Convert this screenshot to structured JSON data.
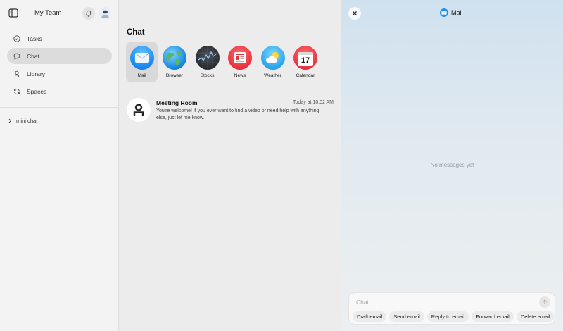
{
  "sidebar": {
    "title": "My Team",
    "toggle_icon": "sidebar-toggle-icon",
    "notifications_icon": "bell-icon",
    "nav": [
      {
        "label": "Tasks",
        "icon": "check-circle-icon",
        "active": false
      },
      {
        "label": "Chat",
        "icon": "chat-bubble-icon",
        "active": true
      },
      {
        "label": "Library",
        "icon": "person-icon",
        "active": false
      },
      {
        "label": "Spaces",
        "icon": "refresh-icon",
        "active": false
      }
    ],
    "mini_chat": "mini chat"
  },
  "chat_list": {
    "title": "Chat",
    "apps": [
      {
        "label": "Mail",
        "icon": "mail-icon",
        "selected": true
      },
      {
        "label": "Browser",
        "icon": "globe-icon",
        "selected": false
      },
      {
        "label": "Stocks",
        "icon": "stocks-icon",
        "selected": false
      },
      {
        "label": "News",
        "icon": "news-icon",
        "selected": false
      },
      {
        "label": "Weather",
        "icon": "weather-icon",
        "selected": false
      },
      {
        "label": "Calendar",
        "icon": "calendar-icon",
        "selected": false,
        "day": "17"
      }
    ],
    "conversation": {
      "name": "Meeting Room",
      "time": "Today at 10:02 AM",
      "preview": "You're welcome! If you ever want to find a video or need help with anything else, just let me know."
    }
  },
  "panel": {
    "title": "Mail",
    "empty_text": "No messages yet",
    "input_placeholder": "Chat",
    "chips": [
      "Draft email",
      "Send email",
      "Reply to email",
      "Forward email",
      "Delete email"
    ]
  },
  "colors": {
    "accent_blue": "#1e8ef0",
    "news_red": "#e8333d",
    "calendar_red": "#e8333d"
  }
}
